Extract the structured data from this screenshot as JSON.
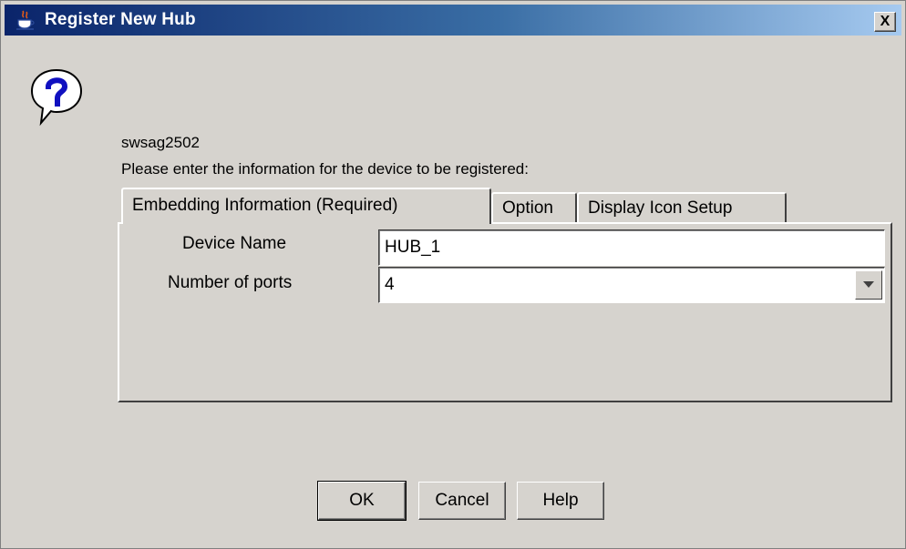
{
  "window": {
    "title": "Register New Hub",
    "close_symbol": "X",
    "title_icon": "java-cup-icon",
    "dialog_icon": "question-icon"
  },
  "message": {
    "id": "swsag2502",
    "text": "Please enter the information for the device to be registered:"
  },
  "tabs": [
    {
      "label": "Embedding Information (Required)",
      "active": true
    },
    {
      "label": "Option",
      "active": false
    },
    {
      "label": "Display Icon Setup",
      "active": false
    }
  ],
  "form": {
    "device_name_label": "Device Name",
    "device_name_value": "HUB_1",
    "ports_label": "Number of ports",
    "ports_value": "4"
  },
  "buttons": {
    "ok": "OK",
    "cancel": "Cancel",
    "help": "Help"
  },
  "colors": {
    "titlebar_start": "#0a246a",
    "titlebar_end": "#a6caf0",
    "face": "#d6d3ce"
  }
}
